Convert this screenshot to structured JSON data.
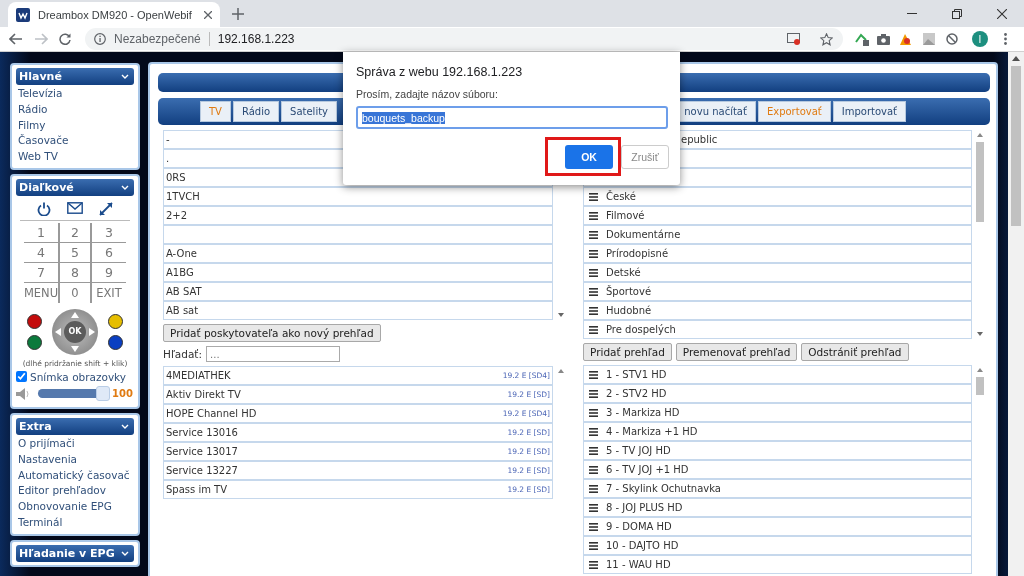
{
  "browser": {
    "tab_title": "Dreambox DM920 - OpenWebif",
    "security_label": "Nezabezpečené",
    "address": "192.168.1.223",
    "profile_initial": "I"
  },
  "sidebar": {
    "main": {
      "title": "Hlavné",
      "items": [
        "Televízia",
        "Rádio",
        "Filmy",
        "Časovače",
        "Web TV"
      ]
    },
    "remote": {
      "title": "Diaľkové",
      "keys": [
        "1",
        "2",
        "3",
        "4",
        "5",
        "6",
        "7",
        "8",
        "9",
        "MENU",
        "0",
        "EXIT"
      ],
      "ok_label": "OK",
      "color_keys": [
        {
          "color": "#c40c0c"
        },
        {
          "color": "#0b7a3c"
        },
        {
          "color": "#e6be00"
        },
        {
          "color": "#0a3fc2"
        }
      ],
      "hint": "(dlhé pridržanie shift + klik)",
      "screenshot": {
        "label": "Snímka obrazovky",
        "checked": true
      },
      "volume": {
        "level": 1,
        "reading": "100"
      }
    },
    "extra": {
      "title": "Extra",
      "items": [
        "O prijímači",
        "Nastavenia",
        "Automatický časovač",
        "Editor prehľadov",
        "Obnovovanie EPG",
        "Terminál"
      ]
    },
    "epg_search": {
      "title": "Hľadanie v EPG"
    }
  },
  "editor": {
    "tabs": [
      {
        "label": "TV",
        "selected": true
      },
      {
        "label": "Rádio",
        "selected": false
      },
      {
        "label": "Satelity",
        "selected": false
      }
    ],
    "actions": [
      {
        "label": "novu načítať",
        "selected": false
      },
      {
        "label": "Exportovať",
        "selected": true
      },
      {
        "label": "Importovať",
        "selected": false
      }
    ],
    "providers": [
      {
        "kind": "provider",
        "name": "-"
      },
      {
        "kind": "provider",
        "name": "."
      },
      {
        "kind": "provider",
        "name": "0RS"
      },
      {
        "kind": "provider",
        "name": "1TVCH"
      },
      {
        "kind": "provider",
        "name": "2+2"
      },
      {
        "kind": "empty"
      },
      {
        "kind": "provider",
        "name": "A-One"
      },
      {
        "kind": "provider",
        "name": "A1BG"
      },
      {
        "kind": "provider",
        "name": "AB SAT"
      },
      {
        "kind": "provider",
        "name": "AB sat"
      }
    ],
    "add_provider_button": "Pridať poskytovateľa ako nový prehľad",
    "search": {
      "label": "Hľadať:",
      "placeholder": "..."
    },
    "channels": [
      {
        "name": "4MEDIATHEK",
        "info": "19.2 E [SD4]"
      },
      {
        "name": "Aktiv Direkt TV",
        "info": "19.2 E [SD]"
      },
      {
        "name": "HOPE Channel HD",
        "info": "19.2 E [SD4]"
      },
      {
        "name": "Service 13016",
        "info": "19.2 E [SD]"
      },
      {
        "name": "Service 13017",
        "info": "19.2 E [SD]"
      },
      {
        "name": "Service 13227",
        "info": "19.2 E [SD]"
      },
      {
        "name": "Spass im TV",
        "info": "19.2 E [SD]"
      }
    ],
    "bouquets": [
      {
        "kind": "covered",
        "name": "epublic"
      },
      {
        "kind": "empty"
      },
      {
        "kind": "empty"
      },
      {
        "kind": "bouquet",
        "name": "České"
      },
      {
        "kind": "bouquet",
        "name": "Filmové"
      },
      {
        "kind": "bouquet",
        "name": "Dokumentárne"
      },
      {
        "kind": "bouquet",
        "name": "Prírodopisné"
      },
      {
        "kind": "bouquet",
        "name": "Detské"
      },
      {
        "kind": "bouquet",
        "name": "Športové"
      },
      {
        "kind": "bouquet",
        "name": "Hudobné"
      },
      {
        "kind": "bouquet",
        "name": "Pre dospelých"
      }
    ],
    "bouquet_buttons": [
      "Pridať prehľad",
      "Premenovať prehľad",
      "Odstrániť prehľad"
    ],
    "bouquet_channels": [
      "1 - STV1 HD",
      "2 - STV2 HD",
      "3 - Markiza HD",
      "4 - Markiza +1 HD",
      "5 - TV JOJ HD",
      "6 - TV JOJ +1 HD",
      "7 - Skylink Ochutnavka",
      "8 - JOJ PLUS HD",
      "9 - DOMA HD",
      "10 - DAJTO HD",
      "11 - WAU HD"
    ]
  },
  "dialog": {
    "title": "Správa z webu 192.168.1.223",
    "prompt": "Prosím, zadajte názov súboru:",
    "value": "bouquets_backup",
    "ok": {
      "label": "OK",
      "highlighted": true
    },
    "cancel": "Zrušiť"
  }
}
